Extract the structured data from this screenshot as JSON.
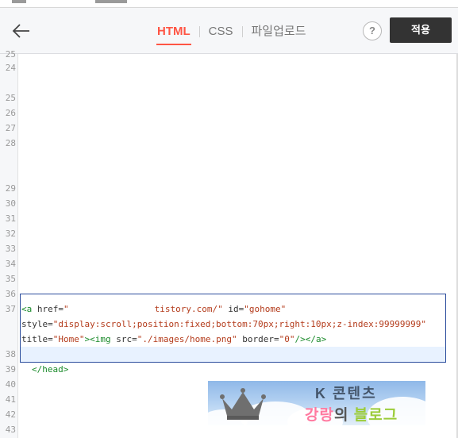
{
  "header": {
    "back_label": "",
    "tabs": [
      {
        "label": "HTML",
        "active": true
      },
      {
        "label": "CSS",
        "active": false
      },
      {
        "label": "파일업로드",
        "active": false
      }
    ],
    "help_label": "?",
    "apply_label": "적용"
  },
  "gutter": {
    "lines": [
      "25",
      "24",
      "25",
      "26",
      "27",
      "28",
      "29",
      "30",
      "31",
      "32",
      "33",
      "34",
      "35",
      "36",
      "37",
      "38",
      "39",
      "40",
      "41",
      "42",
      "43"
    ]
  },
  "code": {
    "line37_a_open": "<a ",
    "line37_href_attr": "href=",
    "line37_href_val_start": "\"",
    "line37_href_val_end": "tistory.com/\"",
    "line37_id_attr": " id=",
    "line37_id_val": "\"gohome\"",
    "line38_style_attr": "style=",
    "line38_style_val": "\"display:scroll;position:fixed;bottom:70px;right:10px;z-index:99999999\"",
    "line39_title_attr": "title=",
    "line39_title_val": "\"Home\"",
    "line39_img_open": "><img ",
    "line39_src_attr": "src=",
    "line39_src_val": "\"./images/home.png\"",
    "line39_border_attr": " border=",
    "line39_border_val": "\"0\"",
    "line39_close": "/></a>",
    "line_head_close": "</head>"
  },
  "banner": {
    "title": "K 콘텐츠",
    "sub_a": "강랑",
    "sub_b": "의",
    "sub_c": "블로그"
  },
  "colors": {
    "accent": "#ff5544",
    "tag": "#1a8a2a",
    "string": "#b43c1c",
    "selection_border": "#2a4c9c"
  }
}
